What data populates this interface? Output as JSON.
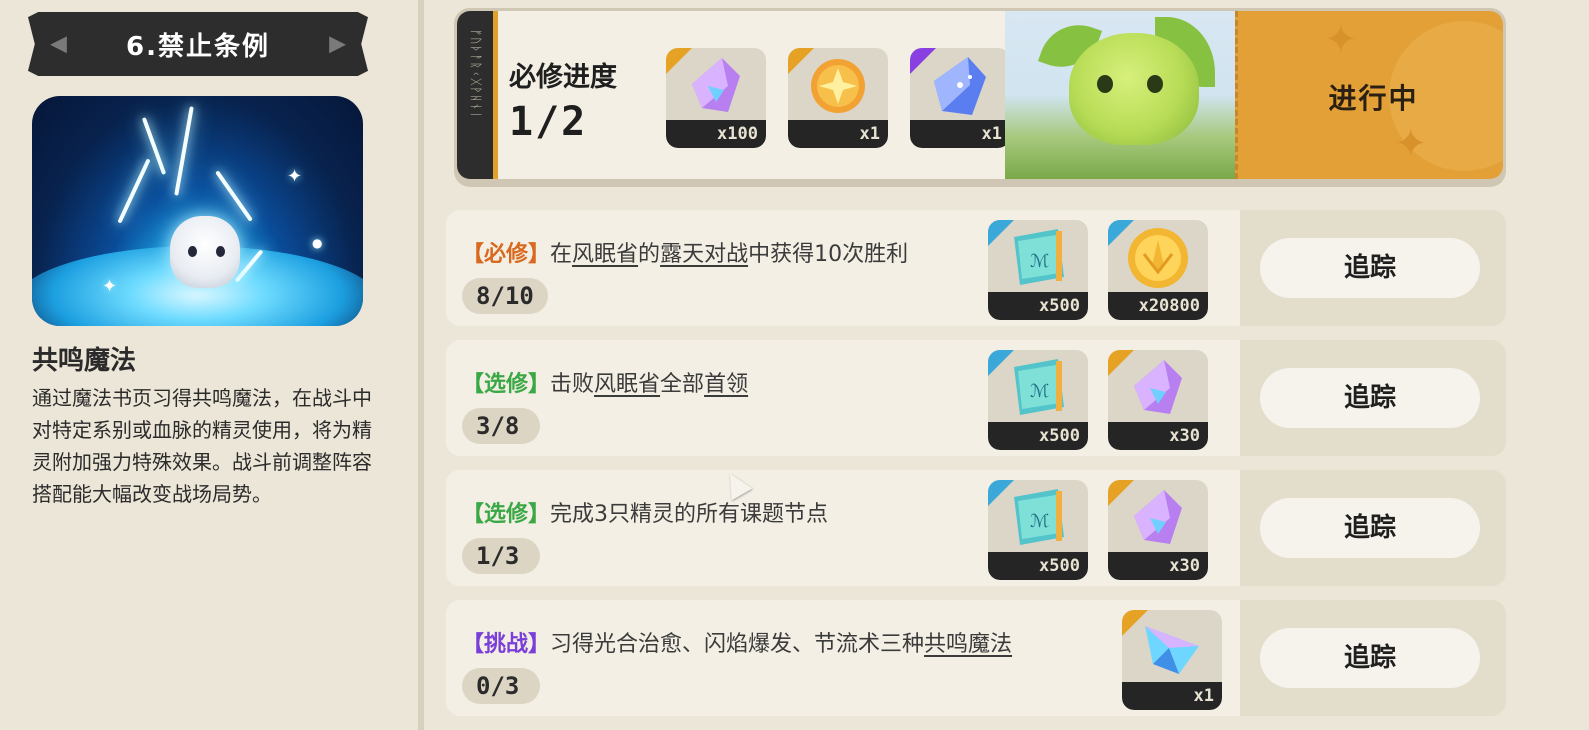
{
  "chapter": {
    "title": "6.禁止条例",
    "prev_icon": "◀",
    "next_icon": "▶"
  },
  "skill": {
    "title": "共鸣魔法",
    "description": "通过魔法书页习得共鸣魔法，在战斗中对特定系别或血脉的精灵使用，将为精灵附加强力特殊效果。战斗前调整阵容搭配能大幅改变战场局势。"
  },
  "progress": {
    "label": "必修进度",
    "value": "1/2",
    "status": "进行中",
    "rewards": [
      {
        "icon": "purple-crystal-icon",
        "qty": "x100",
        "corner_color": "#e5a225"
      },
      {
        "icon": "gold-star-orb-icon",
        "qty": "x1",
        "corner_color": "#e5a225"
      },
      {
        "icon": "blue-gem-icon",
        "qty": "x1",
        "corner_color": "#8a3fe0"
      }
    ]
  },
  "quests": [
    {
      "tag": "【必修】",
      "tag_color": "#d8691f",
      "parts": [
        {
          "text": "在",
          "u": false
        },
        {
          "text": "风眠省",
          "u": true
        },
        {
          "text": "的",
          "u": false
        },
        {
          "text": "露天对战",
          "u": true
        },
        {
          "text": "中获得10次胜利",
          "u": false
        }
      ],
      "count": "8/10",
      "track_label": "追踪",
      "rewards": [
        {
          "icon": "magic-book-icon",
          "qty": "x500",
          "corner_color": "#3aa8d8"
        },
        {
          "icon": "gold-coin-icon",
          "qty": "x20800",
          "corner_color": "#3aa8d8"
        }
      ]
    },
    {
      "tag": "【选修】",
      "tag_color": "#3aa845",
      "parts": [
        {
          "text": "击败",
          "u": false
        },
        {
          "text": "风眠省",
          "u": true
        },
        {
          "text": "全部",
          "u": false
        },
        {
          "text": "首领",
          "u": true
        }
      ],
      "count": "3/8",
      "track_label": "追踪",
      "rewards": [
        {
          "icon": "magic-book-icon",
          "qty": "x500",
          "corner_color": "#3aa8d8"
        },
        {
          "icon": "purple-crystal-icon",
          "qty": "x30",
          "corner_color": "#e5a225"
        }
      ]
    },
    {
      "tag": "【选修】",
      "tag_color": "#3aa845",
      "parts": [
        {
          "text": "完成3只精灵的所有课题节点",
          "u": false
        }
      ],
      "count": "1/3",
      "track_label": "追踪",
      "rewards": [
        {
          "icon": "magic-book-icon",
          "qty": "x500",
          "corner_color": "#3aa8d8"
        },
        {
          "icon": "purple-crystal-icon",
          "qty": "x30",
          "corner_color": "#e5a225"
        }
      ]
    },
    {
      "tag": "【挑战】",
      "tag_color": "#7a3fd8",
      "parts": [
        {
          "text": "习得光合治愈、闪焰爆发、节流术三种",
          "u": false
        },
        {
          "text": "共鸣魔法",
          "u": true
        }
      ],
      "count": "0/3",
      "track_label": "追踪",
      "rewards": [
        {
          "icon": "prism-crystal-icon",
          "qty": "x1",
          "corner_color": "#e5a225"
        }
      ]
    }
  ]
}
